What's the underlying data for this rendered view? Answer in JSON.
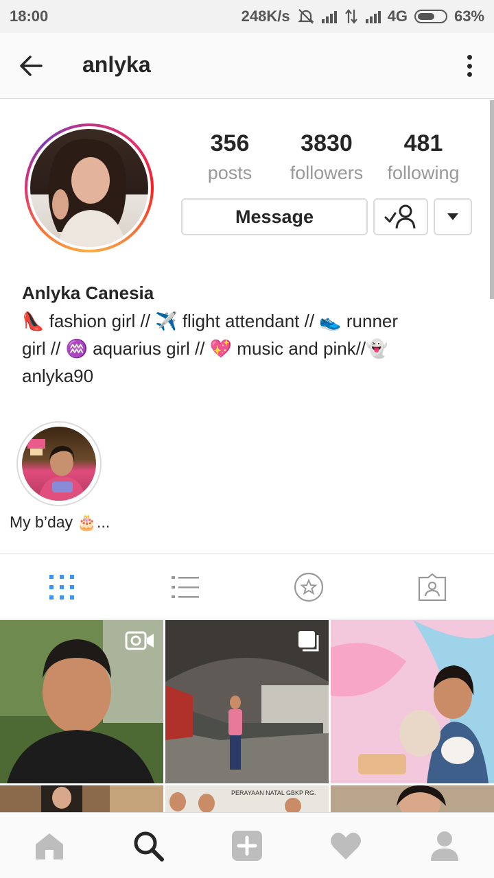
{
  "status_bar": {
    "time": "18:00",
    "speed": "248K/s",
    "network": "4G",
    "battery": "63%",
    "battery_level": 0.63,
    "icons": [
      "mute-icon",
      "signal-icon",
      "data-arrows-icon",
      "signal-icon",
      "battery-icon"
    ]
  },
  "header": {
    "title": "anlyka",
    "back_icon": "arrow-left-icon",
    "menu_icon": "more-vertical-icon"
  },
  "profile": {
    "stats": [
      {
        "value": "356",
        "label": "posts"
      },
      {
        "value": "3830",
        "label": "followers"
      },
      {
        "value": "481",
        "label": "following"
      }
    ],
    "message_label": "Message",
    "follow_icon": "following-check-icon",
    "dropdown_icon": "caret-down-icon",
    "name": "Anlyka Canesia",
    "bio": "👠 fashion girl // ✈️ flight attendant // 👟 runner\ngirl // ♒ aquarius girl // 💖 music and pink//👻\nanlyka90"
  },
  "highlights": [
    {
      "label": "My b’day 🎂..."
    }
  ],
  "tabs": [
    {
      "name": "grid-icon",
      "active": true
    },
    {
      "name": "list-icon",
      "active": false
    },
    {
      "name": "saved-star-icon",
      "active": false
    },
    {
      "name": "tagged-icon",
      "active": false
    }
  ],
  "grid": [
    {
      "badge": "video-icon"
    },
    {
      "badge": "carousel-icon"
    },
    {
      "badge": ""
    },
    {
      "badge": ""
    },
    {
      "badge": "",
      "caption": "PERAYAAN NATAL GBKP RG."
    },
    {
      "badge": ""
    }
  ],
  "bottom_nav": [
    "home-icon",
    "search-icon",
    "add-icon",
    "heart-icon",
    "profile-icon"
  ],
  "colors": {
    "accent_blue": "#3897f0",
    "text": "#262626",
    "muted": "#999999",
    "border": "#dbdbdb"
  }
}
